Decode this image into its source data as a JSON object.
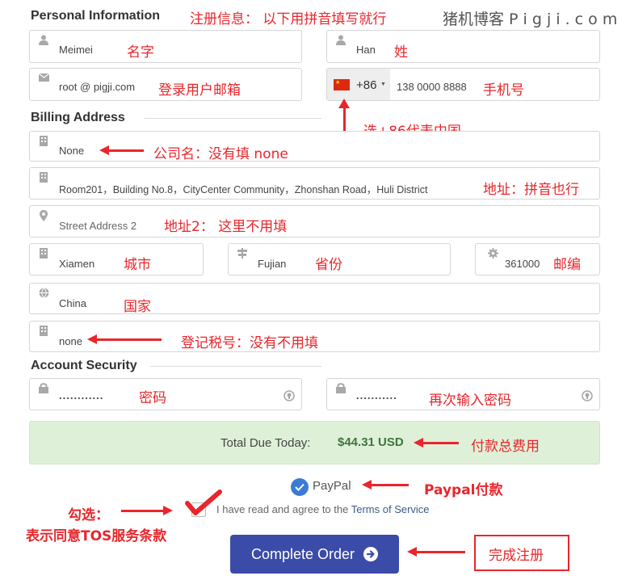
{
  "watermark": "猪机博客 P i g j i . c o m",
  "sections": {
    "personal": "Personal Information",
    "billing": "Billing Address",
    "security": "Account Security"
  },
  "fields": {
    "first_name": "Meimei",
    "last_name": "Han",
    "email": "root @ pigji.com",
    "country_code": "+86",
    "phone": "138 0000 8888",
    "company": "None",
    "address1": "Room201，Building No.8，CityCenter Community，Zhonshan Road，Huli District",
    "address2_placeholder": "Street Address 2",
    "city": "Xiamen",
    "state": "Fujian",
    "postcode": "361000",
    "country": "China",
    "tax_id": "none",
    "password": "............",
    "password_confirm": "..........."
  },
  "total": {
    "label": "Total Due Today:",
    "amount": "$44.31 USD"
  },
  "payment": {
    "label": "PayPal"
  },
  "tos": {
    "text": "I have read and agree to the ",
    "link": "Terms of Service"
  },
  "submit_label": "Complete Order",
  "annotations": {
    "header": "注册信息： 以下用拼音填写就行",
    "first_name": "名字",
    "last_name": "姓",
    "email": "登录用户邮箱",
    "phone": "手机号",
    "country_code": "选+86代表中国",
    "company": "公司名：没有填 none",
    "address1": "地址：拼音也行",
    "address2": "地址2： 这里不用填",
    "city": "城市",
    "state": "省份",
    "postcode": "邮编",
    "country": "国家",
    "tax_id": "登记税号：没有不用填",
    "password": "密码",
    "password_confirm": "再次输入密码",
    "total": "付款总费用",
    "paypal": "Paypal付款",
    "tos_line1": "勾选：",
    "tos_line2": "表示同意TOS服务条款",
    "submit": "完成注册"
  },
  "colors": {
    "annotation": "#e8262c",
    "button": "#3b4ba8",
    "total_bg": "#dff0d8",
    "amount": "#3c763d",
    "check": "#3a7bd5"
  }
}
